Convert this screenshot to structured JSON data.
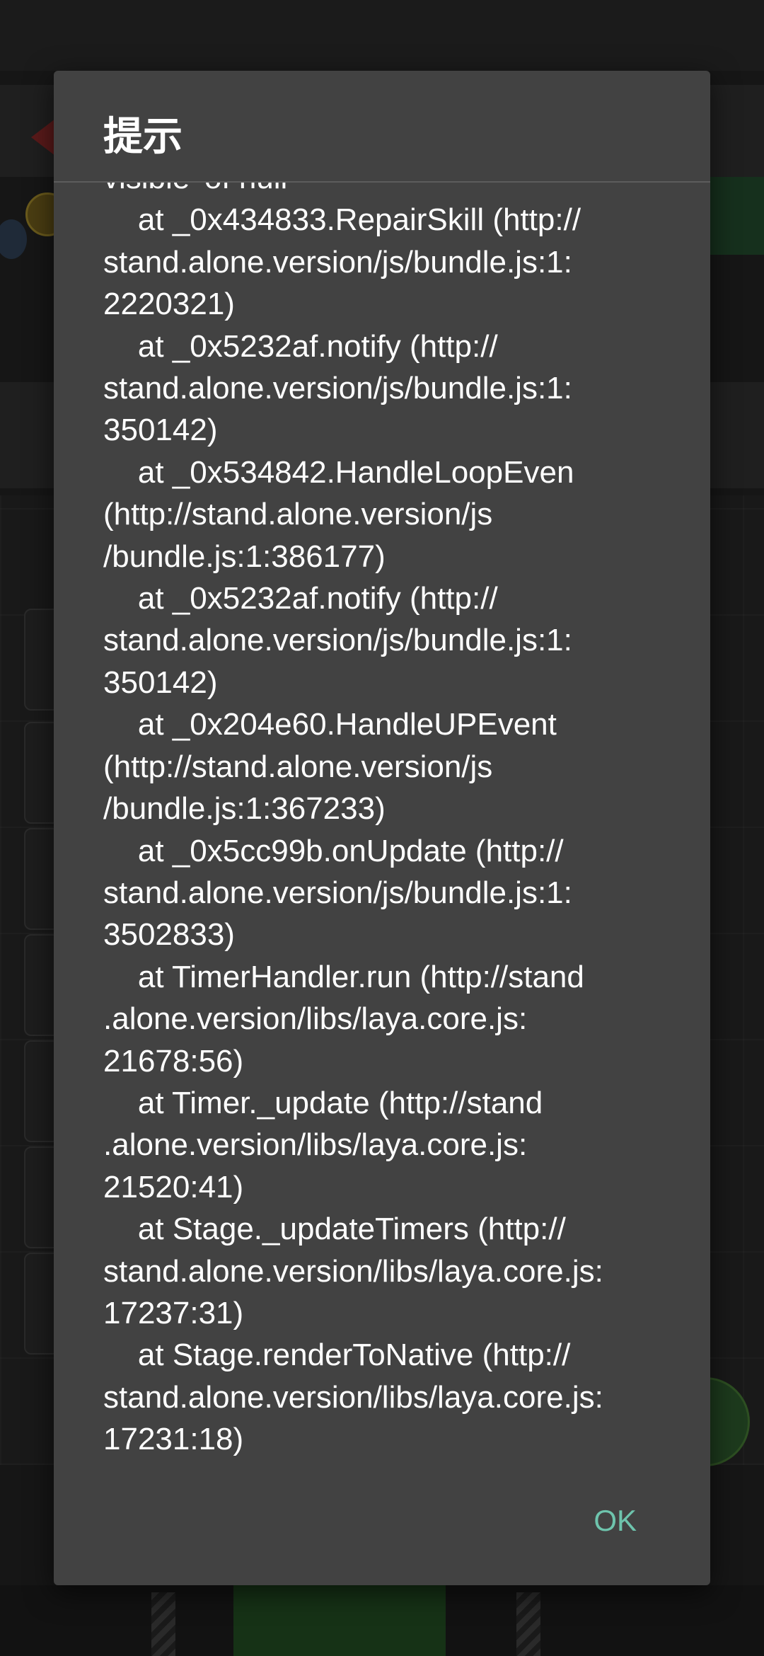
{
  "dialog": {
    "title": "提示",
    "message_lines": [
      "visible' of null",
      "    at _0x434833.RepairSkill (http://",
      "stand.alone.version/js/bundle.js:1:",
      "2220321)",
      "    at _0x5232af.notify (http://",
      "stand.alone.version/js/bundle.js:1:",
      "350142)",
      "    at _0x534842.HandleLoopEven",
      "(http://stand.alone.version/js",
      "/bundle.js:1:386177)",
      "    at _0x5232af.notify (http://",
      "stand.alone.version/js/bundle.js:1:",
      "350142)",
      "    at _0x204e60.HandleUPEvent",
      "(http://stand.alone.version/js",
      "/bundle.js:1:367233)",
      "    at _0x5cc99b.onUpdate (http://",
      "stand.alone.version/js/bundle.js:1:",
      "3502833)",
      "    at TimerHandler.run (http://stand",
      ".alone.version/libs/laya.core.js:",
      "21678:56)",
      "    at Timer._update (http://stand",
      ".alone.version/libs/laya.core.js:",
      "21520:41)",
      "    at Stage._updateTimers (http://",
      "stand.alone.version/libs/laya.core.js:",
      "17237:31)",
      "    at Stage.renderToNative (http://",
      "stand.alone.version/libs/laya.core.js:",
      "17231:18)"
    ],
    "ok_label": "OK"
  }
}
